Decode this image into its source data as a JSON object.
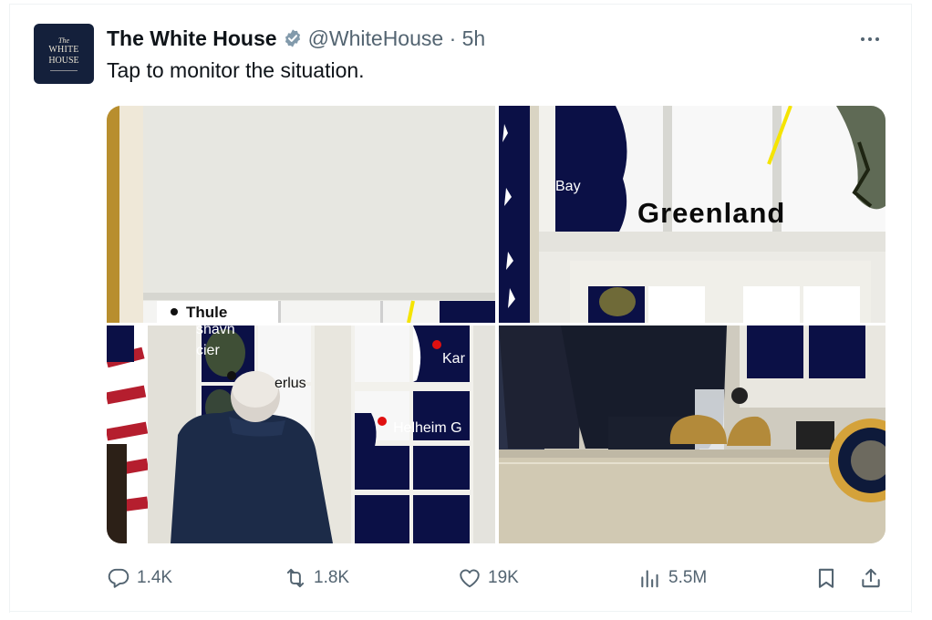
{
  "tweet": {
    "avatar": {
      "line1": "The",
      "line2": "WHITE",
      "line3": "HOUSE"
    },
    "author_name": "The White House",
    "verified": true,
    "handle_time": "@WhiteHouse · 5h",
    "text": "Tap to monitor the situation.",
    "more_icon": "more-horizontal-icon"
  },
  "media": {
    "map_labels": {
      "thule": "Thule",
      "bay": "Bay",
      "greenland": "Greenland",
      "havn": "shavn",
      "cier": "cier",
      "erlus": "erlus",
      "kar": "Kar",
      "helheim": "Helheim G"
    }
  },
  "actions": {
    "replies": "1.4K",
    "reposts": "1.8K",
    "likes": "19K",
    "views": "5.5M"
  },
  "colors": {
    "text": "#0f1419",
    "secondary": "#536471",
    "verified": "#829aab",
    "navy": "#0b1046",
    "border": "#eff3f4"
  }
}
